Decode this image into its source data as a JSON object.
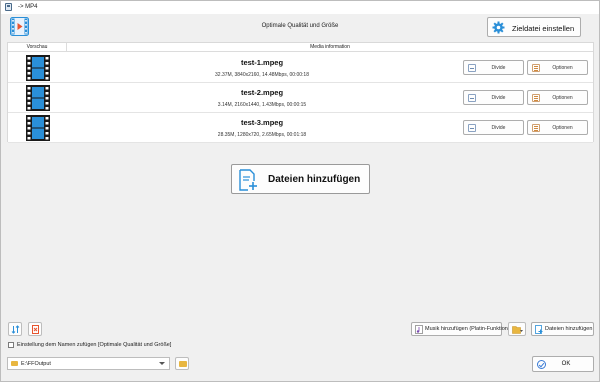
{
  "window": {
    "title": "-> MP4"
  },
  "header": {
    "preset_label": "Optimale Qualität und Größe",
    "target_button_label": "Zieldatei einstellen"
  },
  "table": {
    "columns": [
      "Vorschau",
      "Media information"
    ],
    "rows": [
      {
        "name": "test-1.mpeg",
        "meta": "32.37M, 3840x2160, 14.48Mbps, 00:00:18",
        "divide_label": "Divide",
        "options_label": "Optionen"
      },
      {
        "name": "test-2.mpeg",
        "meta": "3.14M, 2160x1440, 1.43Mbps, 00:00:15",
        "divide_label": "Divide",
        "options_label": "Optionen"
      },
      {
        "name": "test-3.mpeg",
        "meta": "28.35M, 1280x720, 2.65Mbps, 00:01:18",
        "divide_label": "Divide",
        "options_label": "Optionen"
      }
    ]
  },
  "add_files_big_label": "Dateien hinzufügen",
  "toolbar": {
    "music_label": "Musik hinzufügen (Platin-Funktion)",
    "add_files_label": "Dateien hinzufügen"
  },
  "options": {
    "append_setting_label": "Einstellung dem Namen zufügen [Optimale Qualität und Größe]",
    "append_setting_checked": false
  },
  "output": {
    "path": "E:\\FFOutput"
  },
  "ok_label": "OK",
  "colors": {
    "accent": "#3a7bd5",
    "folder": "#e8b640",
    "film_blue": "#2a8fd8"
  }
}
